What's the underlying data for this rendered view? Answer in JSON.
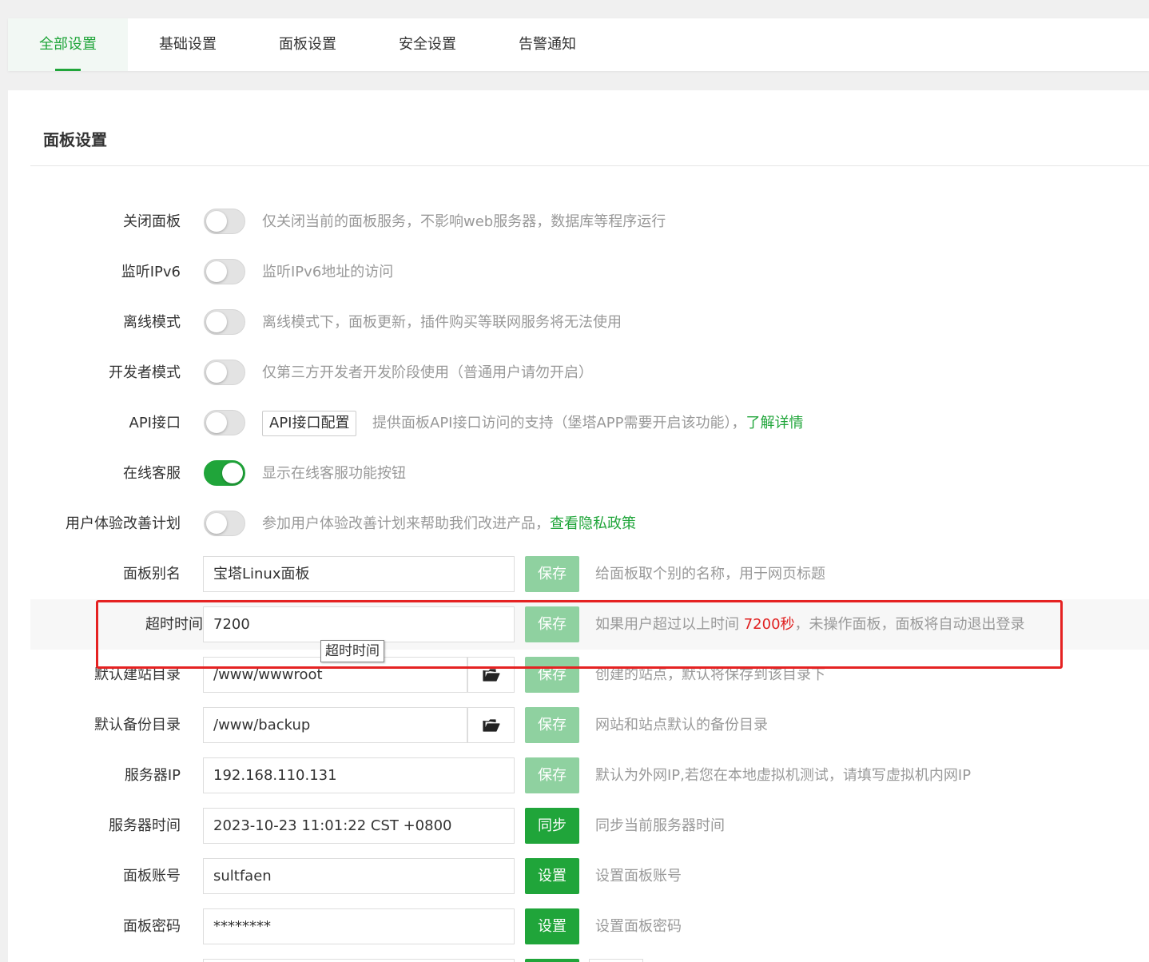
{
  "tabs": [
    "全部设置",
    "基础设置",
    "面板设置",
    "安全设置",
    "告警通知"
  ],
  "panel_title": "面板设置",
  "toggles": [
    {
      "label": "关闭面板",
      "on": false,
      "desc": "仅关闭当前的面板服务，不影响web服务器，数据库等程序运行"
    },
    {
      "label": "监听IPv6",
      "on": false,
      "desc": "监听IPv6地址的访问"
    },
    {
      "label": "离线模式",
      "on": false,
      "desc": "离线模式下，面板更新，插件购买等联网服务将无法使用"
    },
    {
      "label": "开发者模式",
      "on": false,
      "desc": "仅第三方开发者开发阶段使用（普通用户请勿开启）"
    },
    {
      "label": "API接口",
      "on": false,
      "config_button": "API接口配置",
      "desc": "提供面板API接口访问的支持（堡塔APP需要开启该功能），",
      "link": "了解详情"
    },
    {
      "label": "在线客服",
      "on": true,
      "desc": "显示在线客服功能按钮"
    },
    {
      "label": "用户体验改善计划",
      "on": false,
      "desc": "参加用户体验改善计划来帮助我们改进产品，",
      "link": "查看隐私政策"
    }
  ],
  "fields": {
    "alias": {
      "label": "面板别名",
      "value": "宝塔Linux面板",
      "button": "保存",
      "desc": "给面板取个别的名称，用于网页标题"
    },
    "timeout": {
      "label": "超时时间",
      "value": "7200",
      "button": "保存",
      "desc_before": "如果用户超过以上时间 ",
      "desc_highlight": "7200秒",
      "desc_after": "，未操作面板，面板将自动退出登录"
    },
    "site_dir": {
      "label": "默认建站目录",
      "value": "/www/wwwroot",
      "button": "保存",
      "desc": "创建的站点，默认将保存到该目录下"
    },
    "backup_dir": {
      "label": "默认备份目录",
      "value": "/www/backup",
      "button": "保存",
      "desc": "网站和站点默认的备份目录"
    },
    "server_ip": {
      "label": "服务器IP",
      "value": "192.168.110.131",
      "button": "保存",
      "desc": "默认为外网IP,若您在本地虚拟机测试，请填写虚拟机内网IP"
    },
    "server_time": {
      "label": "服务器时间",
      "value": "2023-10-23 11:01:22 CST +0800",
      "button": "同步",
      "desc": "同步当前服务器时间"
    },
    "account": {
      "label": "面板账号",
      "value": "sultfaen",
      "button": "设置",
      "desc": "设置面板账号"
    },
    "password": {
      "label": "面板密码",
      "value": "********",
      "button": "设置",
      "desc": "设置面板密码"
    }
  },
  "tooltip": "超时时间",
  "icons": {
    "folder": "folder-open-icon"
  },
  "colors": {
    "accent": "#20a53a",
    "accent_disabled": "#8fd1a0",
    "highlight_red": "#e02020",
    "annotation_red": "#e52222"
  }
}
